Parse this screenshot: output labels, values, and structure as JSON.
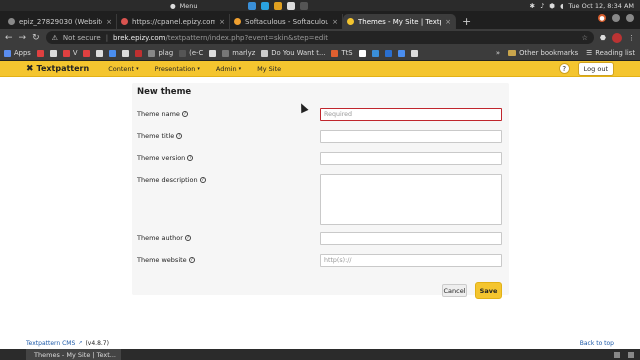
{
  "os": {
    "menu_label": "Menu",
    "clock": "Tue Oct 12,  8:34 AM"
  },
  "tabs": [
    {
      "label": "epiz_27829030 (Website f",
      "active": false,
      "favicon_color": "#888888"
    },
    {
      "label": "https://cpanel.epizy.com",
      "active": false,
      "favicon_color": "#d9534f"
    },
    {
      "label": "Softaculous - Softaculous",
      "active": false,
      "favicon_color": "#f0a030"
    },
    {
      "label": "Themes - My Site | Textpa",
      "active": true,
      "favicon_color": "#f4c52f"
    }
  ],
  "address": {
    "security": "Not secure",
    "host": "brek.epizy.com",
    "path": "/textpattern/index.php?event=skin&step=edit"
  },
  "bookmarks": {
    "items": [
      {
        "label": "Apps",
        "color": "#5b8def"
      },
      {
        "label": "",
        "color": "#e04040"
      },
      {
        "label": "",
        "color": "#dddddd"
      },
      {
        "label": "V",
        "color": "#e04040"
      },
      {
        "label": "",
        "color": "#e04040"
      },
      {
        "label": "",
        "color": "#dddddd"
      },
      {
        "label": "",
        "color": "#4a8ef0"
      },
      {
        "label": "",
        "color": "#dddddd"
      },
      {
        "label": "",
        "color": "#c03030"
      },
      {
        "label": "plag",
        "color": "#888888"
      },
      {
        "label": "(e-C",
        "color": "#555555"
      },
      {
        "label": "",
        "color": "#dddddd"
      },
      {
        "label": "marlyz",
        "color": "#777777"
      },
      {
        "label": "Do You Want t...",
        "color": "#cccccc"
      },
      {
        "label": "TtS",
        "color": "#e06030"
      },
      {
        "label": "",
        "color": "#ffffff"
      },
      {
        "label": "",
        "color": "#3a8fd8"
      },
      {
        "label": "",
        "color": "#2a6fd0"
      },
      {
        "label": "",
        "color": "#4a8ef0"
      },
      {
        "label": "",
        "color": "#dddddd"
      }
    ],
    "more": "»",
    "other": "Other bookmarks",
    "reading": "Reading list"
  },
  "txp": {
    "brand": "Textpattern",
    "menus": [
      "Content",
      "Presentation",
      "Admin"
    ],
    "site": "My Site",
    "help": "?",
    "logout": "Log out"
  },
  "form": {
    "title": "New theme",
    "fields": [
      {
        "label": "Theme name",
        "placeholder": "Required",
        "kind": "input",
        "required": true
      },
      {
        "label": "Theme title",
        "placeholder": "",
        "kind": "input",
        "required": false
      },
      {
        "label": "Theme version",
        "placeholder": "",
        "kind": "input",
        "required": false
      },
      {
        "label": "Theme description",
        "placeholder": "",
        "kind": "textarea",
        "required": false
      },
      {
        "label": "Theme author",
        "placeholder": "",
        "kind": "input",
        "required": false
      },
      {
        "label": "Theme website",
        "placeholder": "http(s)://",
        "kind": "input",
        "required": false
      }
    ],
    "cancel": "Cancel",
    "save": "Save"
  },
  "footer": {
    "cms_link": "Textpattern CMS",
    "version": "(v4.8.7)",
    "back_to_top": "Back to top"
  },
  "taskbar": {
    "window_label": "Themes - My Site | Text..."
  }
}
